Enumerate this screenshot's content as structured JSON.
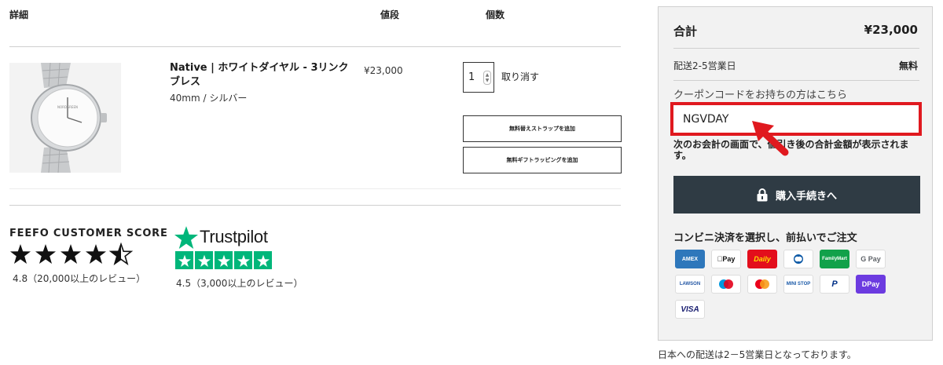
{
  "cart": {
    "headers": {
      "detail": "詳細",
      "price": "値段",
      "qty": "個数"
    },
    "item": {
      "name": "Native | ホワイトダイヤル - 3リンクブレス",
      "variant": "40mm / シルバー",
      "price": "¥23,000",
      "quantity": "1",
      "remove_label": "取り消す",
      "add_strap_label": "無料替えストラップを追加",
      "add_gift_label": "無料ギフトラッピングを追加"
    }
  },
  "reviews": {
    "feefo": {
      "title": "FEEFO CUSTOMER SCORE",
      "rating": 4.5,
      "score_text": "4.8（20,000以上のレビュー）"
    },
    "trustpilot": {
      "brand": "Trustpilot",
      "rating": 5,
      "score_text": "4.5（3,000以上のレビュー）"
    }
  },
  "summary": {
    "total_label": "合計",
    "total_value": "¥23,000",
    "shipping_label": "配送2-5営業日",
    "shipping_value": "無料",
    "coupon_prompt": "クーポンコードをお持ちの方はこちら",
    "coupon_value": "NGVDAY",
    "coupon_note": "次のお会計の画面で、値引き後の合計金額が表示されます。",
    "checkout_label": "購入手続きへ",
    "payment_title": "コンビニ決済を選択し、前払いでご注文",
    "payment_methods": [
      {
        "id": "amex",
        "label": "AMEX"
      },
      {
        "id": "apple",
        "label": "Pay"
      },
      {
        "id": "daily",
        "label": "Daily"
      },
      {
        "id": "diners",
        "label": "D"
      },
      {
        "id": "family",
        "label": "FamilyMart"
      },
      {
        "id": "gpay",
        "label": "G Pay"
      },
      {
        "id": "lawson",
        "label": "LAWSON"
      },
      {
        "id": "maestro",
        "label": ""
      },
      {
        "id": "mastercard",
        "label": ""
      },
      {
        "id": "mini",
        "label": "MINI STOP"
      },
      {
        "id": "paypal",
        "label": "P"
      },
      {
        "id": "dpay",
        "label": "Pay"
      },
      {
        "id": "visa",
        "label": "VISA"
      }
    ],
    "delivery_note": "日本への配送は2－5営業日となっております。"
  },
  "colors": {
    "highlight_red": "#e0191f",
    "checkout_bg": "#2f3b44",
    "trustpilot_green": "#00b67a",
    "summary_bg": "#f2f2f2"
  }
}
